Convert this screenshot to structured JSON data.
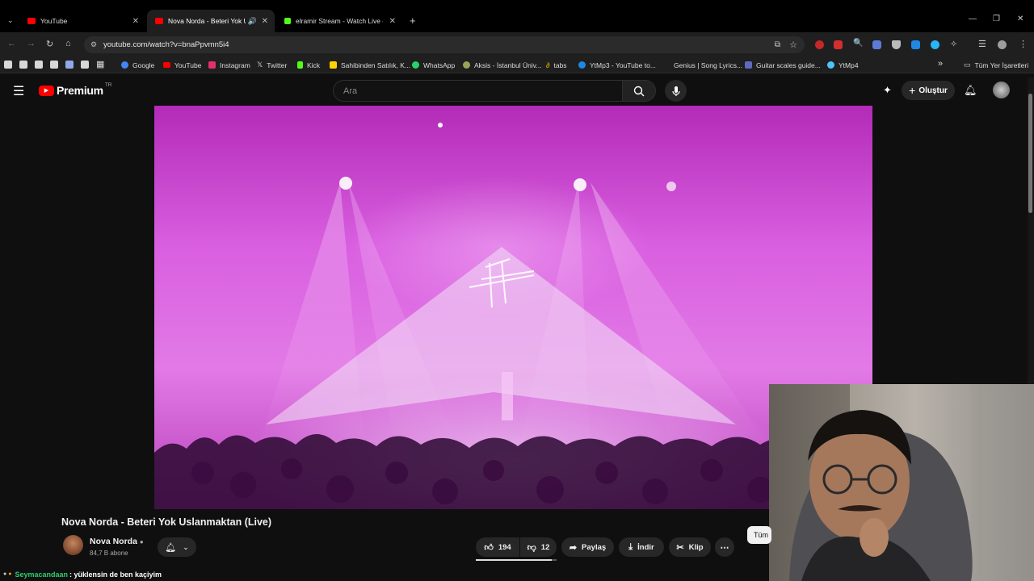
{
  "browser": {
    "tabs": [
      {
        "label": "YouTube",
        "active": false,
        "favicon": "youtube-icon"
      },
      {
        "label": "Nova Norda - Beteri Yok Us",
        "active": true,
        "favicon": "youtube-icon"
      },
      {
        "label": "elramir Stream - Watch Live on",
        "active": false,
        "favicon": "kick-icon"
      }
    ],
    "url": "youtube.com/watch?v=bnaPpvmn5i4",
    "bookmarks": [
      {
        "label": "Google",
        "icon": "google-icon",
        "color": "#4285f4"
      },
      {
        "label": "YouTube",
        "icon": "youtube-icon",
        "color": "#ff0000"
      },
      {
        "label": "Instagram",
        "icon": "instagram-icon",
        "color": "#e1306c"
      },
      {
        "label": "Twitter",
        "icon": "x-icon",
        "color": "#ffffff"
      },
      {
        "label": "Kick",
        "icon": "kick-icon",
        "color": "#53fc18"
      },
      {
        "label": "Sahibinden Satılık, K...",
        "icon": "sahibinden-icon",
        "color": "#ffd200"
      },
      {
        "label": "WhatsApp",
        "icon": "whatsapp-icon",
        "color": "#25d366"
      },
      {
        "label": "Aksis - İstanbul Üniv...",
        "icon": "aksis-icon",
        "color": "#9aa35a"
      },
      {
        "label": "tabs",
        "icon": "tabs-icon",
        "color": "#f0c000"
      },
      {
        "label": "YtMp3 - YouTube to...",
        "icon": "ytmp3-icon",
        "color": "#1e88e5"
      },
      {
        "label": "Genius | Song Lyrics...",
        "icon": "genius-icon",
        "color": "#1f1f1f"
      },
      {
        "label": "Guitar scales guide...",
        "icon": "guitar-icon",
        "color": "#5c6bc0"
      },
      {
        "label": "YtMp4",
        "icon": "cloud-icon",
        "color": "#4fc3f7"
      }
    ],
    "all_bookmarks_label": "Tüm Yer İşaretleri"
  },
  "youtube": {
    "logo_text": "Premium",
    "logo_region": "TR",
    "search_placeholder": "Ara",
    "create_label": "Oluştur",
    "video": {
      "title": "Nova Norda - Beteri Yok Uslanmaktan (Live)",
      "channel": "Nova Norda",
      "subscribers": "84,7 B abone",
      "likes": "194",
      "dislikes": "12",
      "share_label": "Paylaş",
      "download_label": "İndir",
      "clip_label": "Klip"
    },
    "chip_label": "Tüm",
    "chat": {
      "user": "Seymacandaan",
      "message": ": yüklensin de ben kaçiyim"
    }
  },
  "colors": {
    "youtube_red": "#ff0000",
    "background": "#0f0f0f",
    "stage_pink": "#d95fe0"
  }
}
